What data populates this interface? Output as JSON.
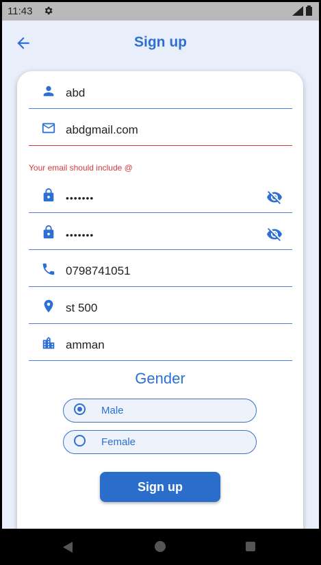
{
  "status_bar": {
    "time": "11:43"
  },
  "app_bar": {
    "title": "Sign up"
  },
  "form": {
    "name": {
      "value": "abd"
    },
    "email": {
      "value": "abdgmail.com",
      "error": "Your email should include @"
    },
    "password": {
      "value": "•••••••"
    },
    "confirm_password": {
      "value": "•••••••"
    },
    "phone": {
      "value": "0798741051"
    },
    "address": {
      "value": "st 500"
    },
    "city": {
      "value": "amman"
    }
  },
  "gender": {
    "title": "Gender",
    "options": [
      {
        "label": "Male",
        "selected": true
      },
      {
        "label": "Female",
        "selected": false
      }
    ]
  },
  "submit": {
    "label": "Sign up"
  },
  "colors": {
    "accent": "#2d6fd2",
    "error": "#d43a3a",
    "background": "#e9effa"
  }
}
